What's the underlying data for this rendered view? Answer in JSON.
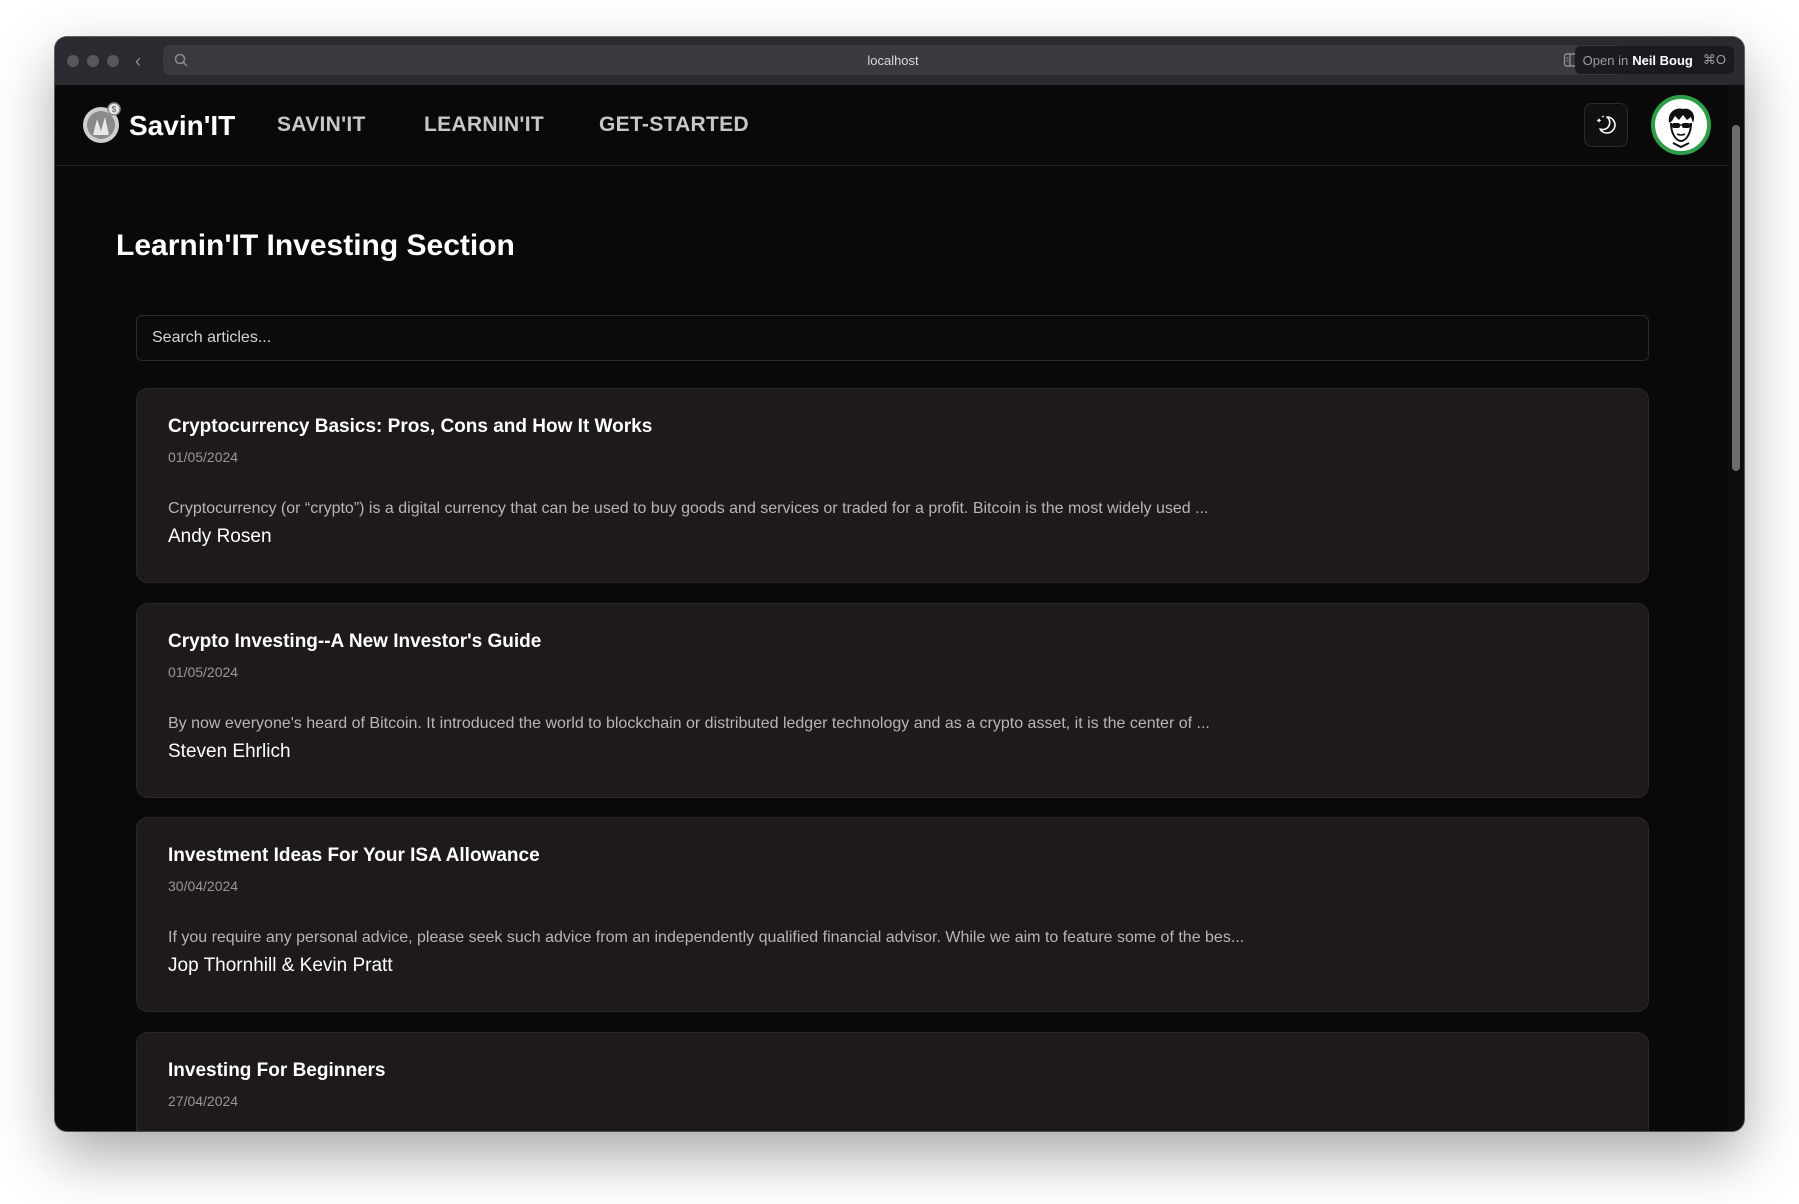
{
  "browser": {
    "url": "localhost",
    "open_in_prefix": "Open in",
    "open_in_name": "Neil Boug",
    "open_in_shortcut": "⌘O"
  },
  "navbar": {
    "brand": "Savin'IT",
    "links": [
      {
        "label": "SAVIN'IT"
      },
      {
        "label": "LEARNIN'IT"
      },
      {
        "label": "GET-STARTED"
      }
    ]
  },
  "page": {
    "title": "Learnin'IT Investing Section",
    "search_placeholder": "Search articles..."
  },
  "articles": [
    {
      "title": "Cryptocurrency Basics: Pros, Cons and How It Works",
      "date": "01/05/2024",
      "excerpt": "Cryptocurrency (or “crypto”) is a digital currency that can be used to buy goods and services or traded for a profit. Bitcoin is the most widely used ...",
      "author": "Andy Rosen"
    },
    {
      "title": "Crypto Investing--A New Investor's Guide",
      "date": "01/05/2024",
      "excerpt": "By now everyone's heard of Bitcoin. It introduced the world to blockchain or distributed ledger technology and as a crypto asset, it is the center of ...",
      "author": "Steven Ehrlich"
    },
    {
      "title": "Investment Ideas For Your ISA Allowance",
      "date": "30/04/2024",
      "excerpt": "If you require any personal advice, please seek such advice from an independently qualified financial advisor. While we aim to feature some of the bes...",
      "author": "Jop Thornhill & Kevin Pratt"
    },
    {
      "title": "Investing For Beginners",
      "date": "27/04/2024",
      "excerpt": "",
      "author": ""
    }
  ],
  "colors": {
    "background": "#0a0909",
    "card": "#1d1a19",
    "avatar_ring": "#2e9e4a"
  }
}
